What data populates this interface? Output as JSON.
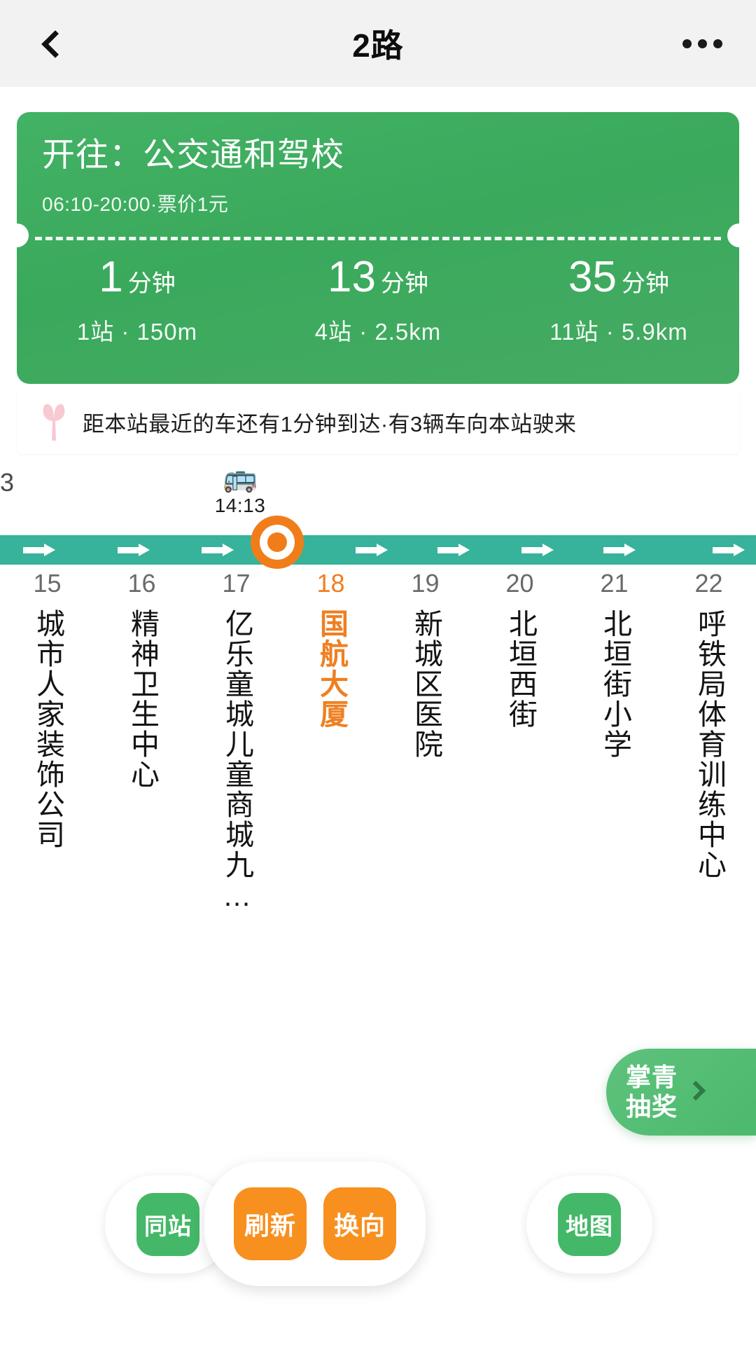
{
  "header": {
    "title": "2路",
    "back_icon": "chevron-left-icon",
    "more_icon": "more-horizontal-icon"
  },
  "route_card": {
    "destination_label": "开往：",
    "destination": "公交通和驾校",
    "destination_full": "开往：公交通和驾校",
    "schedule": "06:10-20:00·票价1元",
    "arrivals": [
      {
        "minutes": "1",
        "unit": "分钟",
        "stops_distance": "1站 · 150m"
      },
      {
        "minutes": "13",
        "unit": "分钟",
        "stops_distance": "4站 · 2.5km"
      },
      {
        "minutes": "35",
        "unit": "分钟",
        "stops_distance": "11站 · 5.9km"
      }
    ]
  },
  "notice": {
    "icon": "flower-icon",
    "text": "距本站最近的车还有1分钟到达·有3辆车向本站驶来"
  },
  "timeline": {
    "bus_icon": "bus-icon",
    "bus_time": "14:13",
    "edge_partial_number": "3",
    "current_station_index": 3,
    "marker_icon": "location-pin-icon",
    "stations": [
      {
        "num": "15",
        "name": "城市人家装饰公司",
        "active": false
      },
      {
        "num": "16",
        "name": "精神卫生中心",
        "active": false
      },
      {
        "num": "17",
        "name": "亿乐童城儿童商城九…",
        "active": false
      },
      {
        "num": "18",
        "name": "国航大厦",
        "active": true
      },
      {
        "num": "19",
        "name": "新城区医院",
        "active": false
      },
      {
        "num": "20",
        "name": "北垣西街",
        "active": false
      },
      {
        "num": "21",
        "name": "北垣街小学",
        "active": false
      },
      {
        "num": "22",
        "name": "呼铁局体育训练中心",
        "active": false
      }
    ]
  },
  "lottery": {
    "line1": "掌青",
    "line2": "抽奖",
    "chevron_icon": "chevron-right-icon"
  },
  "toolbar": {
    "same_station": "同站",
    "refresh": "刷新",
    "switch_direction": "换向",
    "map": "地图"
  },
  "colors": {
    "green": "#43b265",
    "teal_track": "#36b39a",
    "orange": "#f7901e",
    "orange_active": "#ef7f21",
    "header_bg": "#f2f2f2"
  }
}
